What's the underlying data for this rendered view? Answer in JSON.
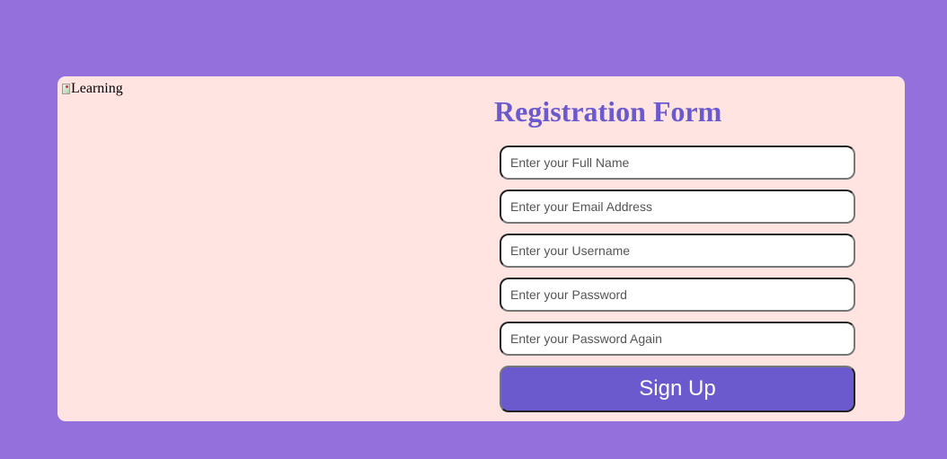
{
  "image": {
    "alt": "Learning"
  },
  "form": {
    "title": "Registration Form",
    "fields": [
      {
        "placeholder": "Enter your Full Name",
        "value": ""
      },
      {
        "placeholder": "Enter your Email Address",
        "value": ""
      },
      {
        "placeholder": "Enter your Username",
        "value": ""
      },
      {
        "placeholder": "Enter your Password",
        "value": ""
      },
      {
        "placeholder": "Enter your Password Again",
        "value": ""
      }
    ],
    "submit_label": "Sign Up"
  },
  "colors": {
    "page_background": "#9370db",
    "card_background": "#ffe4e1",
    "accent": "#6a5acd",
    "button_text": "#ffffff"
  }
}
